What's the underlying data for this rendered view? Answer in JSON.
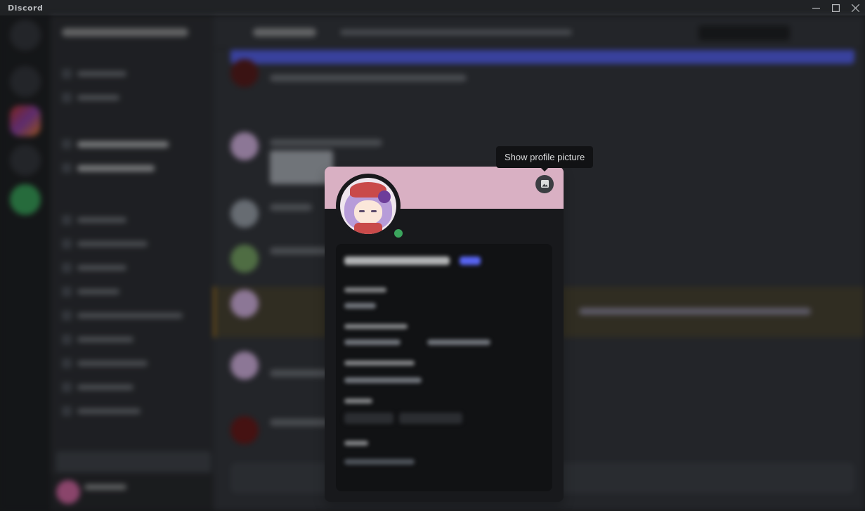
{
  "window": {
    "title": "Discord"
  },
  "tooltip": {
    "text": "Show profile picture"
  },
  "profile": {
    "banner_color": "#d9b0c3",
    "status": "online",
    "status_color": "#3ba55d"
  },
  "icons": {
    "banner_button": "image-icon",
    "minimize": "minimize-icon",
    "maximize": "maximize-icon",
    "close": "close-icon"
  },
  "colors": {
    "accent": "#5865f2",
    "background": "#36393f",
    "sidebar": "#2f3136",
    "guild_bar": "#202225"
  }
}
